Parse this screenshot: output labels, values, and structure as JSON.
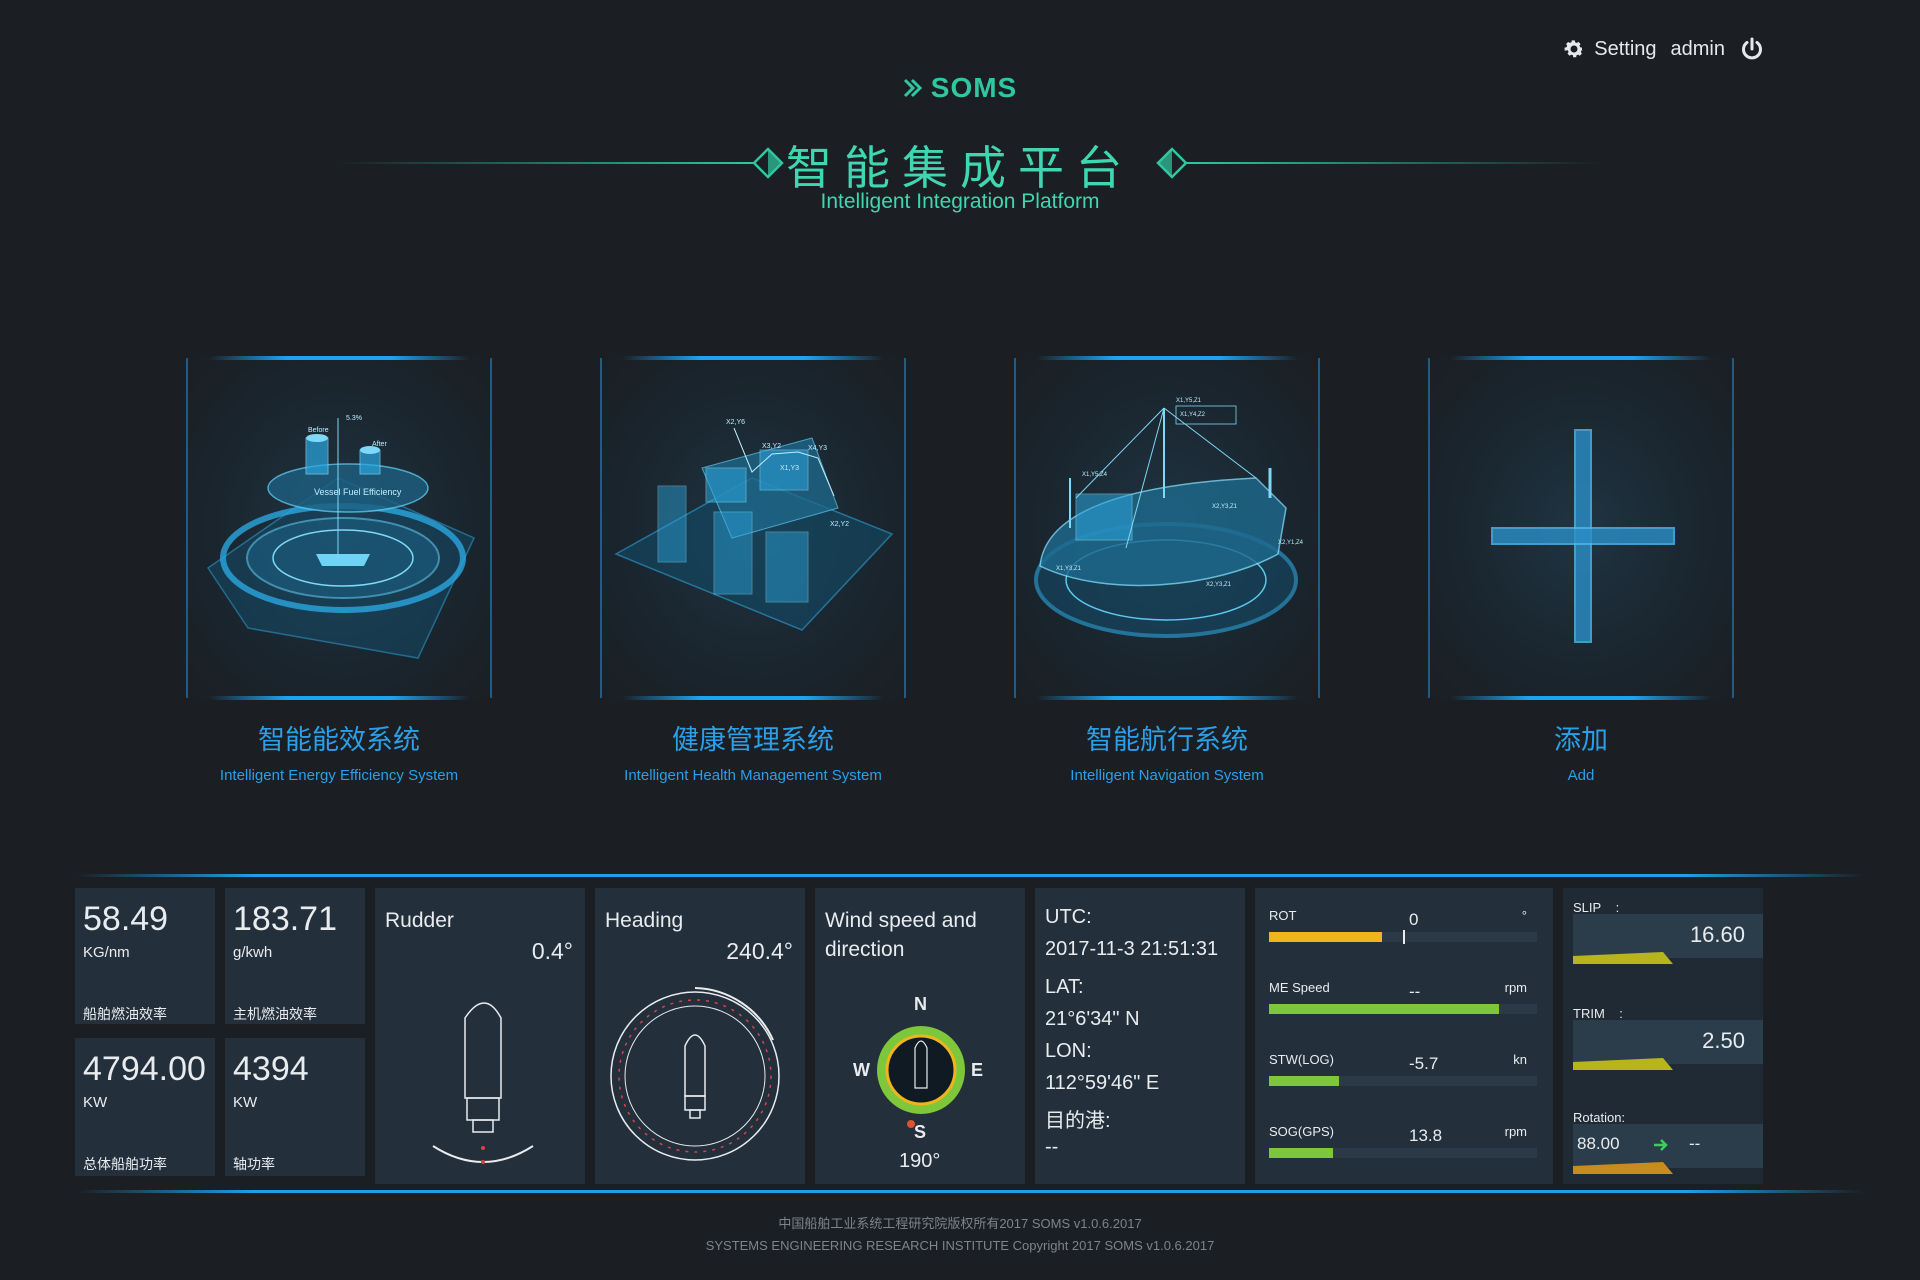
{
  "topbar": {
    "setting_label": "Setting",
    "user_label": "admin"
  },
  "header": {
    "logo_text": "SOMS",
    "title_cn": "智能集成平台",
    "title_en": "Intelligent Integration Platform"
  },
  "modules": [
    {
      "cn": "智能能效系统",
      "en": "Intelligent Energy Efficiency System",
      "image_text": [
        "Vessel Fuel Efficiency",
        "Before",
        "After",
        "5.3%"
      ]
    },
    {
      "cn": "健康管理系统",
      "en": "Intelligent Health Management System",
      "image_text": [
        "X2,Y6",
        "X3,Y2",
        "X4,Y3",
        "X1,Y3",
        "X2,Y2"
      ]
    },
    {
      "cn": "智能航行系统",
      "en": "Intelligent Navigation System",
      "image_text": [
        "X1,Y5,Z1",
        "X1,Y4,Z2",
        "X1,Y5,Z4",
        "X2,Y3,Z1",
        "X2,Y1,Z4",
        "X1,Y3,Z1",
        "X2,Y3,Z1"
      ]
    },
    {
      "cn": "添加",
      "en": "Add"
    }
  ],
  "dashboard": {
    "fuel_eff": {
      "value": "58.49",
      "unit": "KG/nm",
      "label": "船舶燃油效率"
    },
    "me_fuel": {
      "value": "183.71",
      "unit": "g/kwh",
      "label": "主机燃油效率"
    },
    "total_power": {
      "value": "4794.00",
      "unit": "KW",
      "label": "总体船舶功率"
    },
    "shaft_power": {
      "value": "4394",
      "unit": "KW",
      "label": "轴功率"
    },
    "rudder": {
      "title": "Rudder",
      "value": "0.4°"
    },
    "heading": {
      "title": "Heading",
      "value": "240.4°"
    },
    "wind": {
      "title": "Wind speed and direction",
      "n": "N",
      "s": "S",
      "e": "E",
      "w": "W",
      "value": "190°"
    },
    "position": {
      "utc_label": "UTC:",
      "utc_value": "2017-11-3 21:51:31",
      "lat_label": "LAT:",
      "lat_value": "21°6'34\" N",
      "lon_label": "LON:",
      "lon_value": "112°59'46\" E",
      "dest_label": "目的港:",
      "dest_value": "--"
    },
    "bars": [
      {
        "name": "ROT",
        "value": "0",
        "unit": "°",
        "fill": 0.42,
        "color": "#f0b51e"
      },
      {
        "name": "ME Speed",
        "value": "--",
        "unit": "rpm",
        "fill": 0.86,
        "color": "#7ec63a"
      },
      {
        "name": "STW(LOG)",
        "value": "-5.7",
        "unit": "kn",
        "fill": 0.26,
        "color": "#7ec63a"
      },
      {
        "name": "SOG(GPS)",
        "value": "13.8",
        "unit": "rpm",
        "fill": 0.24,
        "color": "#7ec63a"
      }
    ],
    "trim": {
      "slip_label": "SLIP",
      "slip_colon": ":",
      "slip_value": "16.60",
      "trim_label": "TRIM",
      "trim_colon": ":",
      "trim_value": "2.50",
      "rotation_label": "Rotation:",
      "rotation_value": "88.00",
      "rotation_extra": "--"
    }
  },
  "footer": {
    "line1": "中国船舶工业系统工程研究院版权所有2017 SOMS v1.0.6.2017",
    "line2": "SYSTEMS ENGINEERING RESEARCH INSTITUTE Copyright 2017 SOMS v1.0.6.2017"
  },
  "colors": {
    "accent_teal": "#2fc7a1",
    "accent_blue": "#2b9fe8",
    "panel_bg": "#232f3b",
    "page_bg": "#1b1e22"
  }
}
